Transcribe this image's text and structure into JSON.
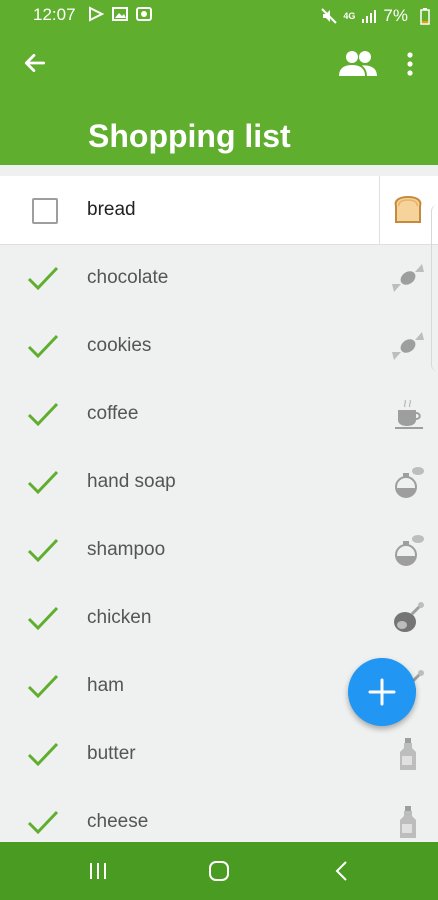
{
  "status_bar": {
    "time": "12:07",
    "network": "4G",
    "battery": "7%"
  },
  "app_bar": {
    "title": "Shopping list"
  },
  "items": [
    {
      "name": "bread",
      "checked": false,
      "icon": "bread-icon"
    },
    {
      "name": "chocolate",
      "checked": true,
      "icon": "candy-icon"
    },
    {
      "name": "cookies",
      "checked": true,
      "icon": "candy-icon"
    },
    {
      "name": "coffee",
      "checked": true,
      "icon": "coffee-cup-icon"
    },
    {
      "name": "hand soap",
      "checked": true,
      "icon": "perfume-bottle-icon"
    },
    {
      "name": "shampoo",
      "checked": true,
      "icon": "perfume-bottle-icon"
    },
    {
      "name": "chicken",
      "checked": true,
      "icon": "meat-icon"
    },
    {
      "name": "ham",
      "checked": true,
      "icon": "meat-icon"
    },
    {
      "name": "butter",
      "checked": true,
      "icon": "milk-bottle-icon"
    },
    {
      "name": "cheese",
      "checked": true,
      "icon": "milk-bottle-icon"
    }
  ],
  "colors": {
    "accent": "#5fae2e",
    "fab": "#2196f3",
    "check": "#5fae2e"
  }
}
